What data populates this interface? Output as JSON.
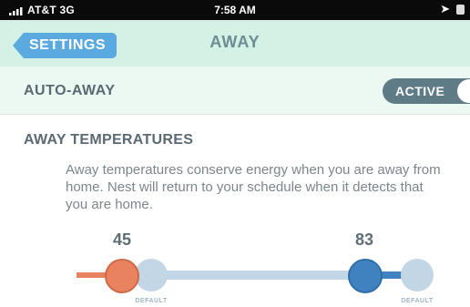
{
  "status_bar": {
    "carrier": "AT&T",
    "network": "3G",
    "time": "7:58 AM",
    "location_icon": "location-arrow-icon",
    "battery_icon": "battery-icon"
  },
  "nav": {
    "back_label": "SETTINGS",
    "title": "AWAY"
  },
  "auto_away": {
    "label": "AUTO-AWAY",
    "toggle_label": "ACTIVE",
    "state": "on"
  },
  "away_temperatures": {
    "heading": "AWAY TEMPERATURES",
    "description": "Away temperatures conserve energy when you are away from home. Nest will return to your schedule when it detects that you are home.",
    "low_value": "45",
    "high_value": "83",
    "default_label_left": "DEFAULT",
    "default_label_right": "DEFAULT"
  },
  "colors": {
    "heat": "#e9825f",
    "cool": "#3f82bf",
    "track": "#c2d6e6",
    "nav_background": "#d4f1e6",
    "back_button": "#5aa9df"
  }
}
